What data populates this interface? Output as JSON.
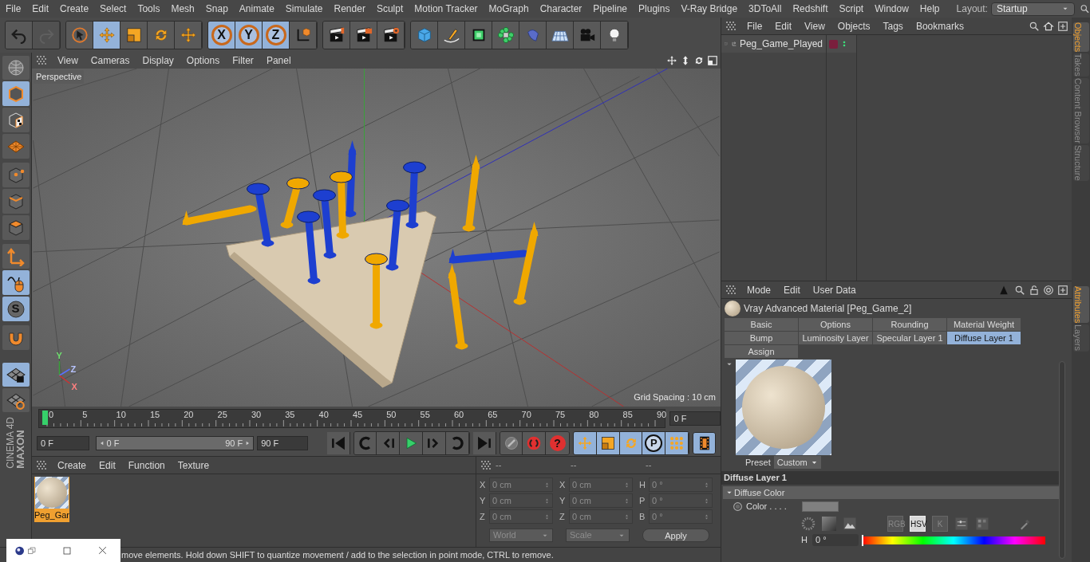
{
  "menu_bar": {
    "items": [
      "File",
      "Edit",
      "Create",
      "Select",
      "Tools",
      "Mesh",
      "Snap",
      "Animate",
      "Simulate",
      "Render",
      "Sculpt",
      "Motion Tracker",
      "MoGraph",
      "Character",
      "Pipeline",
      "Plugins",
      "V-Ray Bridge",
      "3DToAll",
      "Redshift",
      "Script",
      "Window",
      "Help"
    ],
    "layout_label": "Layout:",
    "layout_value": "Startup"
  },
  "toolbar": {
    "history": [
      {
        "disabled": false
      },
      {
        "disabled": true
      }
    ],
    "tools": [
      {
        "selected": false
      },
      {
        "selected": true
      },
      {
        "selected": false
      },
      {
        "selected": false
      },
      {
        "selected": false
      }
    ],
    "axes": [
      {
        "label": "X",
        "selected": true
      },
      {
        "label": "Y",
        "selected": true
      },
      {
        "label": "Z",
        "selected": true
      }
    ]
  },
  "mode_tools": [
    {
      "selected": true
    },
    {
      "selected": false
    },
    {
      "selected": false
    },
    {
      "selected": false
    },
    {
      "selected": false
    },
    {
      "selected": false
    },
    {
      "selected": false
    },
    {
      "selected": true
    },
    {
      "label": "S",
      "selected": true
    },
    {
      "selected": false
    }
  ],
  "lock_tools": [
    {
      "selected": true
    },
    {
      "selected": false
    }
  ],
  "logo": [
    "MAXON",
    "CINEMA 4D"
  ],
  "viewport": {
    "menu": [
      "View",
      "Cameras",
      "Display",
      "Options",
      "Filter",
      "Panel"
    ],
    "camera_label": "Perspective",
    "grid_spacing": "Grid Spacing : 10 cm",
    "axis_labels": [
      "Y",
      "Z",
      "X"
    ]
  },
  "timeline": {
    "ticks": [
      "0",
      "5",
      "10",
      "15",
      "20",
      "25",
      "30",
      "35",
      "40",
      "45",
      "50",
      "55",
      "60",
      "65",
      "70",
      "75",
      "80",
      "85",
      "90"
    ],
    "level": 0,
    "current_frame": "0 F"
  },
  "playback": {
    "start_field": "0 F",
    "range_start": "0 F",
    "range_end": "90 F",
    "range_level": {
      "level": 1
    },
    "end_field": "90 F",
    "help_label": "?",
    "key_tracks": [
      {
        "selected": true
      },
      {
        "selected": true
      },
      {
        "selected": true
      },
      {
        "label": "P",
        "selected": true
      },
      {
        "selected": true
      }
    ]
  },
  "materials": {
    "menu": [
      "Create",
      "Edit",
      "Function",
      "Texture"
    ],
    "items": [
      {
        "name": "Peg_Gar",
        "selected": true
      }
    ]
  },
  "coordinates": {
    "headers": [
      "--",
      "--",
      "--"
    ],
    "rows": [
      {
        "labels": [
          "X",
          "X",
          "H"
        ],
        "values": [
          "0 cm",
          "0 cm",
          "0 °"
        ]
      },
      {
        "labels": [
          "Y",
          "Y",
          "P"
        ],
        "values": [
          "0 cm",
          "0 cm",
          "0 °"
        ]
      },
      {
        "labels": [
          "Z",
          "Z",
          "B"
        ],
        "values": [
          "0 cm",
          "0 cm",
          "0 °"
        ]
      }
    ],
    "dropdowns": [
      "World",
      "Scale"
    ],
    "apply": "Apply"
  },
  "status_bar": "move elements. Hold down SHIFT to quantize movement / add to the selection in point mode, CTRL to remove.",
  "objects_panel": {
    "menu": [
      "File",
      "Edit",
      "View",
      "Objects",
      "Tags",
      "Bookmarks"
    ],
    "objects": [
      {
        "name": "Peg_Game_Played",
        "color": "#7a1f3d"
      }
    ]
  },
  "side_tabs_top": [
    {
      "label": "Objects",
      "selected": true
    },
    {
      "label": "Takes",
      "selected": false
    },
    {
      "label": "Content Browser",
      "selected": false
    },
    {
      "label": "Structure",
      "selected": false
    }
  ],
  "attributes": {
    "menu": [
      "Mode",
      "Edit",
      "User Data"
    ],
    "title": "Vray Advanced Material [Peg_Game_2]",
    "tabs": [
      {
        "label": "Basic",
        "selected": false
      },
      {
        "label": "Options",
        "selected": false
      },
      {
        "label": "Rounding",
        "selected": false
      },
      {
        "label": "Material Weight",
        "selected": false
      },
      {
        "label": "Bump",
        "selected": false
      },
      {
        "label": "Luminosity Layer",
        "selected": false
      },
      {
        "label": "Specular Layer 1",
        "selected": false
      },
      {
        "label": "Diffuse Layer 1",
        "selected": true
      },
      {
        "label": "Assign",
        "selected": false
      }
    ],
    "preset_label": "Preset",
    "preset_value": "Custom",
    "section": "Diffuse Layer 1",
    "group": {
      "label": "Diffuse Color",
      "expanded": true
    },
    "color_label": "Color . . . .",
    "color_modes": [
      {
        "label": "RGB",
        "selected": false
      },
      {
        "label": "HSV",
        "selected": true
      },
      {
        "label": "K",
        "selected": false
      }
    ],
    "hue": {
      "label": "H",
      "value": "0 °",
      "level": 0
    }
  },
  "side_tabs_bottom": [
    {
      "label": "Attributes",
      "selected": true
    },
    {
      "label": "Layers",
      "selected": false
    }
  ]
}
